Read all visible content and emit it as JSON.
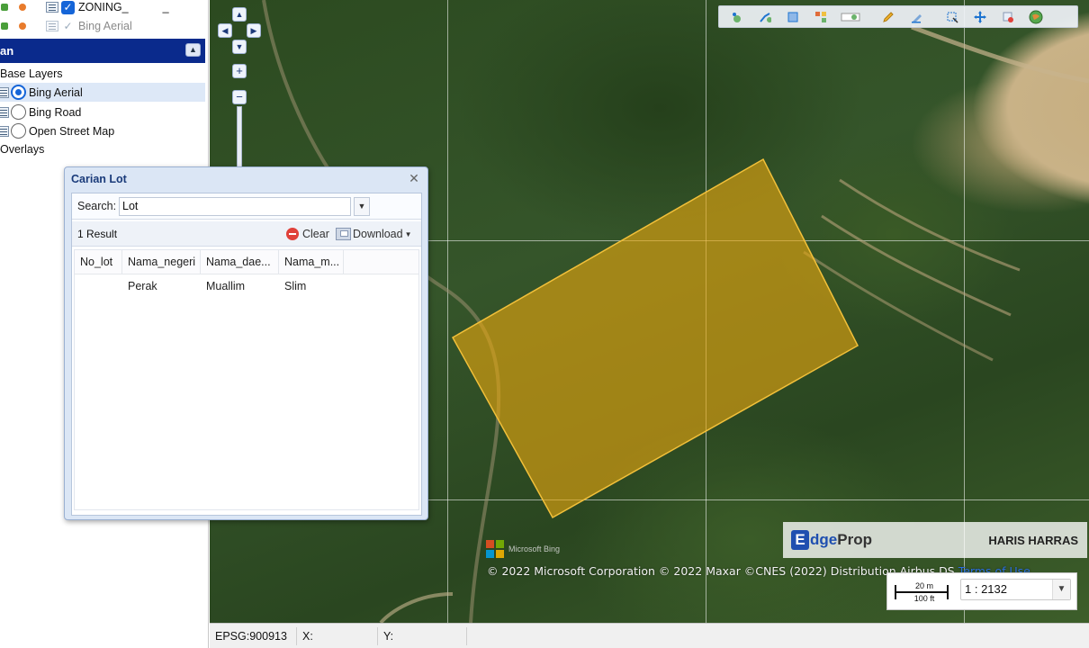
{
  "layers_top": [
    {
      "label": "ZONING_",
      "checked": true,
      "suffix": "_"
    },
    {
      "label": "Bing Aerial",
      "checked": false
    }
  ],
  "panel": {
    "title": "an",
    "base_layers_label": "Base Layers",
    "base_layers": [
      {
        "label": "Bing Aerial",
        "selected": true
      },
      {
        "label": "Bing Road",
        "selected": false
      },
      {
        "label": "Open Street Map",
        "selected": false
      }
    ],
    "overlays_label": "Overlays"
  },
  "dialog": {
    "title": "Carian Lot",
    "search_label": "Search:",
    "search_value": "Lot",
    "result_count": "1 Result",
    "clear_label": "Clear",
    "download_label": "Download",
    "columns": [
      "No_lot",
      "Nama_negeri",
      "Nama_dae...",
      "Nama_m..."
    ],
    "rows": [
      [
        "",
        "Perak",
        "Muallim",
        "Slim"
      ]
    ]
  },
  "map": {
    "polygon_color": "#e6a70e",
    "bing_logo_text": "Microsoft Bing",
    "copyright": "© 2022 Microsoft Corporation © 2022 Maxar ©CNES (2022) Distribution Airbus DS",
    "terms_label": "Terms of Use",
    "watermark": {
      "brand_e": "E",
      "brand_dge": "dge",
      "brand_prop": "Prop",
      "name": "HARIS HARRAS"
    },
    "scale": {
      "meters": "20 m",
      "feet": "100 ft",
      "ratio": "1 : 2132"
    },
    "toolbar_icons": [
      "add-point-icon",
      "add-line-icon",
      "add-polygon-icon",
      "measure-icon",
      "toggle-icon",
      "pencil-icon",
      "erase-icon",
      "select-icon",
      "pan-icon",
      "delete-select-icon",
      "globe-icon"
    ]
  },
  "status": {
    "epsg": "EPSG:900913",
    "x_label": "X:",
    "y_label": "Y:"
  }
}
